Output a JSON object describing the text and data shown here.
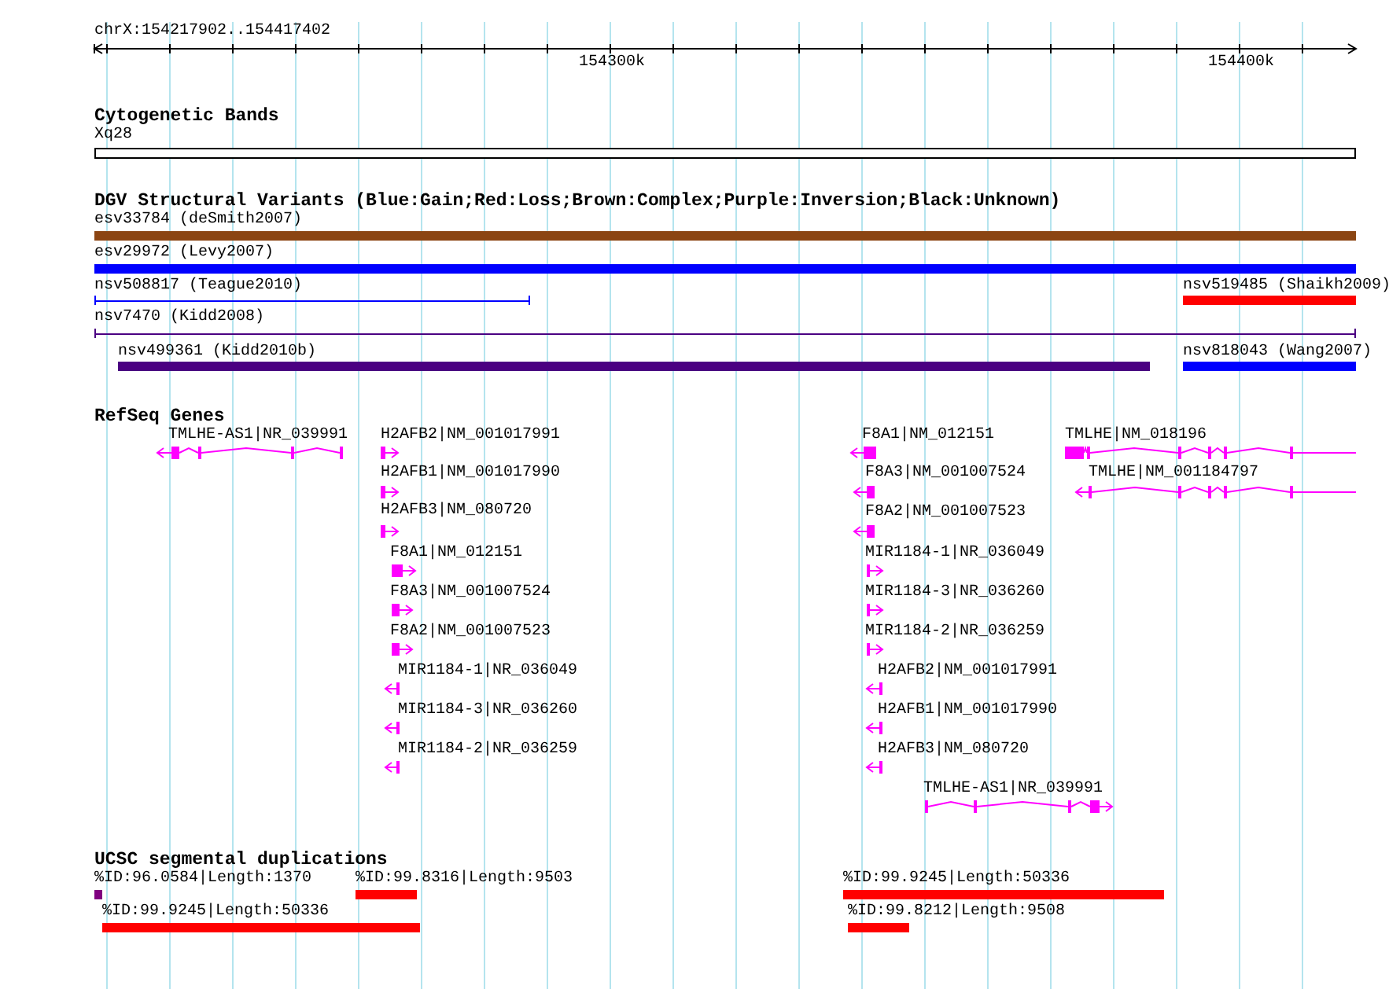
{
  "ruler": {
    "range": "chrX:154217902..154417402",
    "tick_labels": [
      "154300k",
      "154400k"
    ]
  },
  "cytogenetic_bands": {
    "title": "Cytogenetic Bands",
    "features": [
      {
        "label": "Xq28"
      }
    ]
  },
  "dgv": {
    "title": "DGV Structural Variants (Blue:Gain;Red:Loss;Brown:Complex;Purple:Inversion;Black:Unknown)",
    "features": [
      {
        "label": "esv33784 (deSmith2007)",
        "kind": "bar",
        "color": "#8b4513"
      },
      {
        "label": "esv29972 (Levy2007)",
        "kind": "bar",
        "color": "#0000ff"
      },
      {
        "label": "nsv508817 (Teague2010)",
        "kind": "line",
        "color": "#0000ff"
      },
      {
        "label": "nsv519485 (Shaikh2009)",
        "kind": "bar",
        "color": "#ff0000"
      },
      {
        "label": "nsv7470 (Kidd2008)",
        "kind": "line",
        "color": "#4b0082"
      },
      {
        "label": "nsv499361 (Kidd2010b)",
        "kind": "bar",
        "color": "#4b0082"
      },
      {
        "label": "nsv818043 (Wang2007)",
        "kind": "bar",
        "color": "#0000ff"
      }
    ]
  },
  "refseq": {
    "title": "RefSeq Genes",
    "genes": [
      {
        "label": "TMLHE-AS1|NR_039991",
        "reverse_strand": true
      },
      {
        "label": "H2AFB2|NM_001017991",
        "reverse_strand": false
      },
      {
        "label": "H2AFB1|NM_001017990",
        "reverse_strand": false
      },
      {
        "label": "H2AFB3|NM_080720",
        "reverse_strand": false
      },
      {
        "label": "F8A1|NM_012151",
        "reverse_strand": false
      },
      {
        "label": "F8A3|NM_001007524",
        "reverse_strand": false
      },
      {
        "label": "F8A2|NM_001007523",
        "reverse_strand": false
      },
      {
        "label": "MIR1184-1|NR_036049",
        "reverse_strand": true
      },
      {
        "label": "MIR1184-3|NR_036260",
        "reverse_strand": true
      },
      {
        "label": "MIR1184-2|NR_036259",
        "reverse_strand": true
      },
      {
        "label": "F8A1|NM_012151",
        "reverse_strand": true
      },
      {
        "label": "F8A3|NM_001007524",
        "reverse_strand": true
      },
      {
        "label": "F8A2|NM_001007523",
        "reverse_strand": true
      },
      {
        "label": "MIR1184-1|NR_036049",
        "reverse_strand": false
      },
      {
        "label": "MIR1184-3|NR_036260",
        "reverse_strand": false
      },
      {
        "label": "MIR1184-2|NR_036259",
        "reverse_strand": false
      },
      {
        "label": "H2AFB2|NM_001017991",
        "reverse_strand": true
      },
      {
        "label": "H2AFB1|NM_001017990",
        "reverse_strand": true
      },
      {
        "label": "H2AFB3|NM_080720",
        "reverse_strand": true
      },
      {
        "label": "TMLHE-AS1|NR_039991",
        "reverse_strand": false
      },
      {
        "label": "TMLHE|NM_018196"
      },
      {
        "label": "TMLHE|NM_001184797",
        "reverse_strand": true
      }
    ]
  },
  "segmental_duplications": {
    "title": "UCSC segmental duplications",
    "features": [
      {
        "label": "%ID:96.0584|Length:1370",
        "color": "#800080"
      },
      {
        "label": "%ID:99.8316|Length:9503",
        "color": "#ff0000"
      },
      {
        "label": "%ID:99.9245|Length:50336",
        "color": "#ff0000"
      },
      {
        "label": "%ID:99.9245|Length:50336",
        "color": "#ff0000"
      },
      {
        "label": "%ID:99.8212|Length:9508",
        "color": "#ff0000"
      }
    ]
  }
}
